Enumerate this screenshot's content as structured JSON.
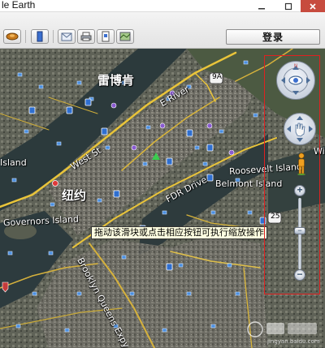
{
  "window": {
    "title": "le Earth"
  },
  "toolbar": {
    "login_label": "登录"
  },
  "map": {
    "labels": {
      "leidongke": "雷博肯",
      "niuyue": "纽约",
      "governors": "Governors Island",
      "roosevelt": "Roosevelt Island",
      "belmont": "Belmont Island",
      "fdr": "FDR Drive",
      "brooklyn_queens": "Brooklyn Queens Expy",
      "west": "West St",
      "island_left": "Island",
      "east_river": "E River",
      "route9a": "9A",
      "route25": "25",
      "wi": "Wi"
    },
    "tooltip": "拖动该滑块或点击相应按钮可执行缩放操作"
  },
  "nav": {
    "zoom_plus": "+",
    "zoom_minus": "−",
    "zoom_thumb": "−"
  },
  "watermark": {
    "text": "jingyan.baidu.com"
  }
}
